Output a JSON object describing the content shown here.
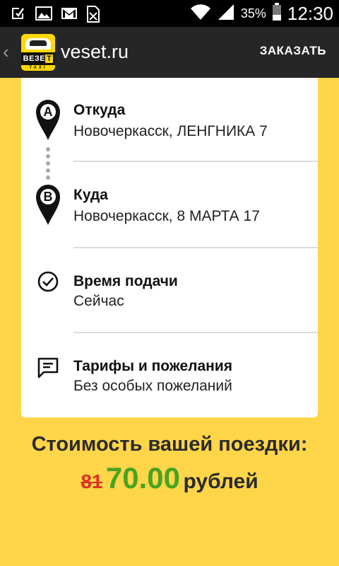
{
  "status_bar": {
    "battery_percent": "35%",
    "time": "12:30",
    "icons": [
      "download-done-icon",
      "image-icon",
      "gmail-icon",
      "sim-card-icon",
      "wifi-icon",
      "signal-icon",
      "battery-icon"
    ]
  },
  "action_bar": {
    "back_icon": "‹",
    "logo_word": "ВЕЗЕ",
    "logo_letter": "Т",
    "logo_sub": "TAXI",
    "title": "veset.ru",
    "order_label": "ЗАКАЗАТЬ"
  },
  "route": {
    "from": {
      "marker": "A",
      "label": "Откуда",
      "value": "Новочеркасск, ЛЕНГНИКА 7"
    },
    "to": {
      "marker": "B",
      "label": "Куда",
      "value": "Новочеркасск, 8 МАРТА 17"
    }
  },
  "pickup_time": {
    "label": "Время подачи",
    "value": "Сейчас"
  },
  "tariffs": {
    "label": "Тарифы и пожелания",
    "value": "Без особых пожеланий"
  },
  "price": {
    "title": "Стоимость вашей поездки:",
    "old": "81",
    "new": "70.00",
    "currency": "рублей"
  },
  "colors": {
    "background": "#FFD54A",
    "action_bar": "#262626",
    "new_price": "#49A320",
    "old_price": "#E03020"
  }
}
